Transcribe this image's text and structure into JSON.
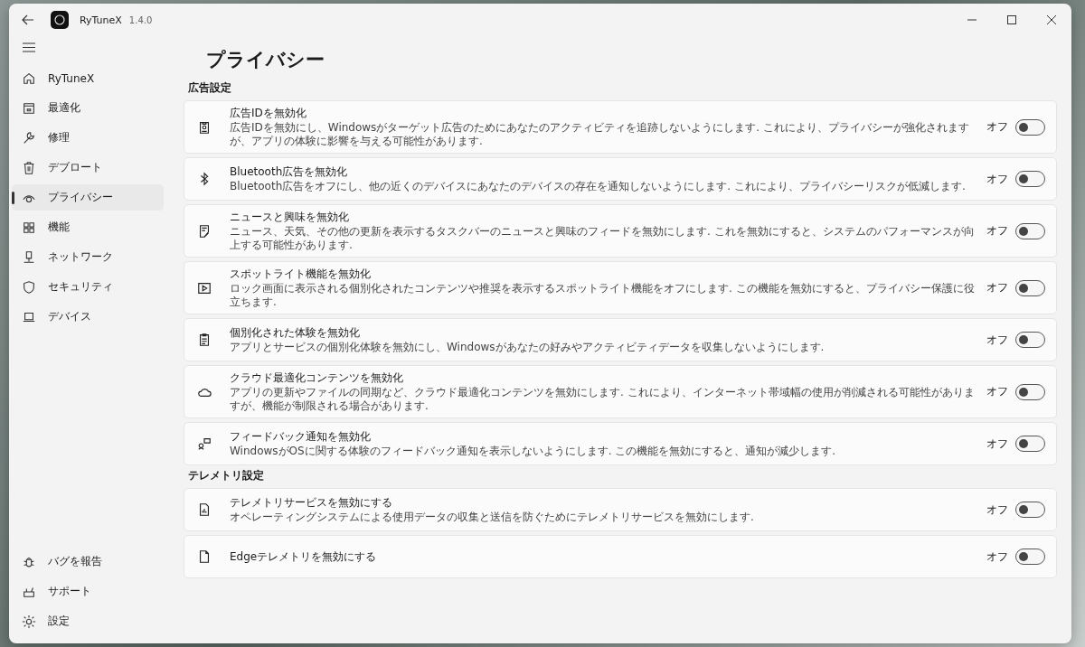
{
  "window": {
    "app_name": "RyTuneX",
    "version": "1.4.0"
  },
  "sidebar": {
    "items": [
      {
        "label": "RyTuneX",
        "selected": false
      },
      {
        "label": "最適化",
        "selected": false
      },
      {
        "label": "修理",
        "selected": false
      },
      {
        "label": "デブロート",
        "selected": false
      },
      {
        "label": "プライバシー",
        "selected": true
      },
      {
        "label": "機能",
        "selected": false
      },
      {
        "label": "ネットワーク",
        "selected": false
      },
      {
        "label": "セキュリティ",
        "selected": false
      },
      {
        "label": "デバイス",
        "selected": false
      }
    ],
    "footer_items": [
      {
        "label": "バグを報告",
        "selected": false
      },
      {
        "label": "サポート",
        "selected": false
      },
      {
        "label": "設定",
        "selected": false
      }
    ]
  },
  "page": {
    "title": "プライバシー",
    "sections": [
      {
        "heading": "広告設定",
        "items": [
          {
            "title": "広告IDを無効化",
            "description": "広告IDを無効にし、Windowsがターゲット広告のためにあなたのアクティビティを追跡しないようにします. これにより、プライバシーが強化されますが、アプリの体験に影響を与える可能性があります.",
            "toggle": {
              "label": "オフ",
              "on": false
            }
          },
          {
            "title": "Bluetooth広告を無効化",
            "description": "Bluetooth広告をオフにし、他の近くのデバイスにあなたのデバイスの存在を通知しないようにします. これにより、プライバシーリスクが低減します.",
            "toggle": {
              "label": "オフ",
              "on": false
            }
          },
          {
            "title": "ニュースと興味を無効化",
            "description": "ニュース、天気、その他の更新を表示するタスクバーのニュースと興味のフィードを無効にします. これを無効にすると、システムのパフォーマンスが向上する可能性があります.",
            "toggle": {
              "label": "オフ",
              "on": false
            }
          },
          {
            "title": "スポットライト機能を無効化",
            "description": "ロック画面に表示される個別化されたコンテンツや推奨を表示するスポットライト機能をオフにします. この機能を無効にすると、プライバシー保護に役立ちます.",
            "toggle": {
              "label": "オフ",
              "on": false
            }
          },
          {
            "title": "個別化された体験を無効化",
            "description": "アプリとサービスの個別化体験を無効にし、Windowsがあなたの好みやアクティビティデータを収集しないようにします.",
            "toggle": {
              "label": "オフ",
              "on": false
            }
          },
          {
            "title": "クラウド最適化コンテンツを無効化",
            "description": "アプリの更新やファイルの同期など、クラウド最適化コンテンツを無効にします. これにより、インターネット帯域幅の使用が削減される可能性がありますが、機能が制限される場合があります.",
            "toggle": {
              "label": "オフ",
              "on": false
            }
          },
          {
            "title": "フィードバック通知を無効化",
            "description": "WindowsがOSに関する体験のフィードバック通知を表示しないようにします. この機能を無効にすると、通知が減少します.",
            "toggle": {
              "label": "オフ",
              "on": false
            }
          }
        ]
      },
      {
        "heading": "テレメトリ設定",
        "items": [
          {
            "title": "テレメトリサービスを無効にする",
            "description": "オペレーティングシステムによる使用データの収集と送信を防ぐためにテレメトリサービスを無効にします.",
            "toggle": {
              "label": "オフ",
              "on": false
            }
          },
          {
            "title": "Edgeテレメトリを無効にする",
            "toggle": {
              "label": "オフ",
              "on": false
            }
          }
        ]
      }
    ]
  }
}
